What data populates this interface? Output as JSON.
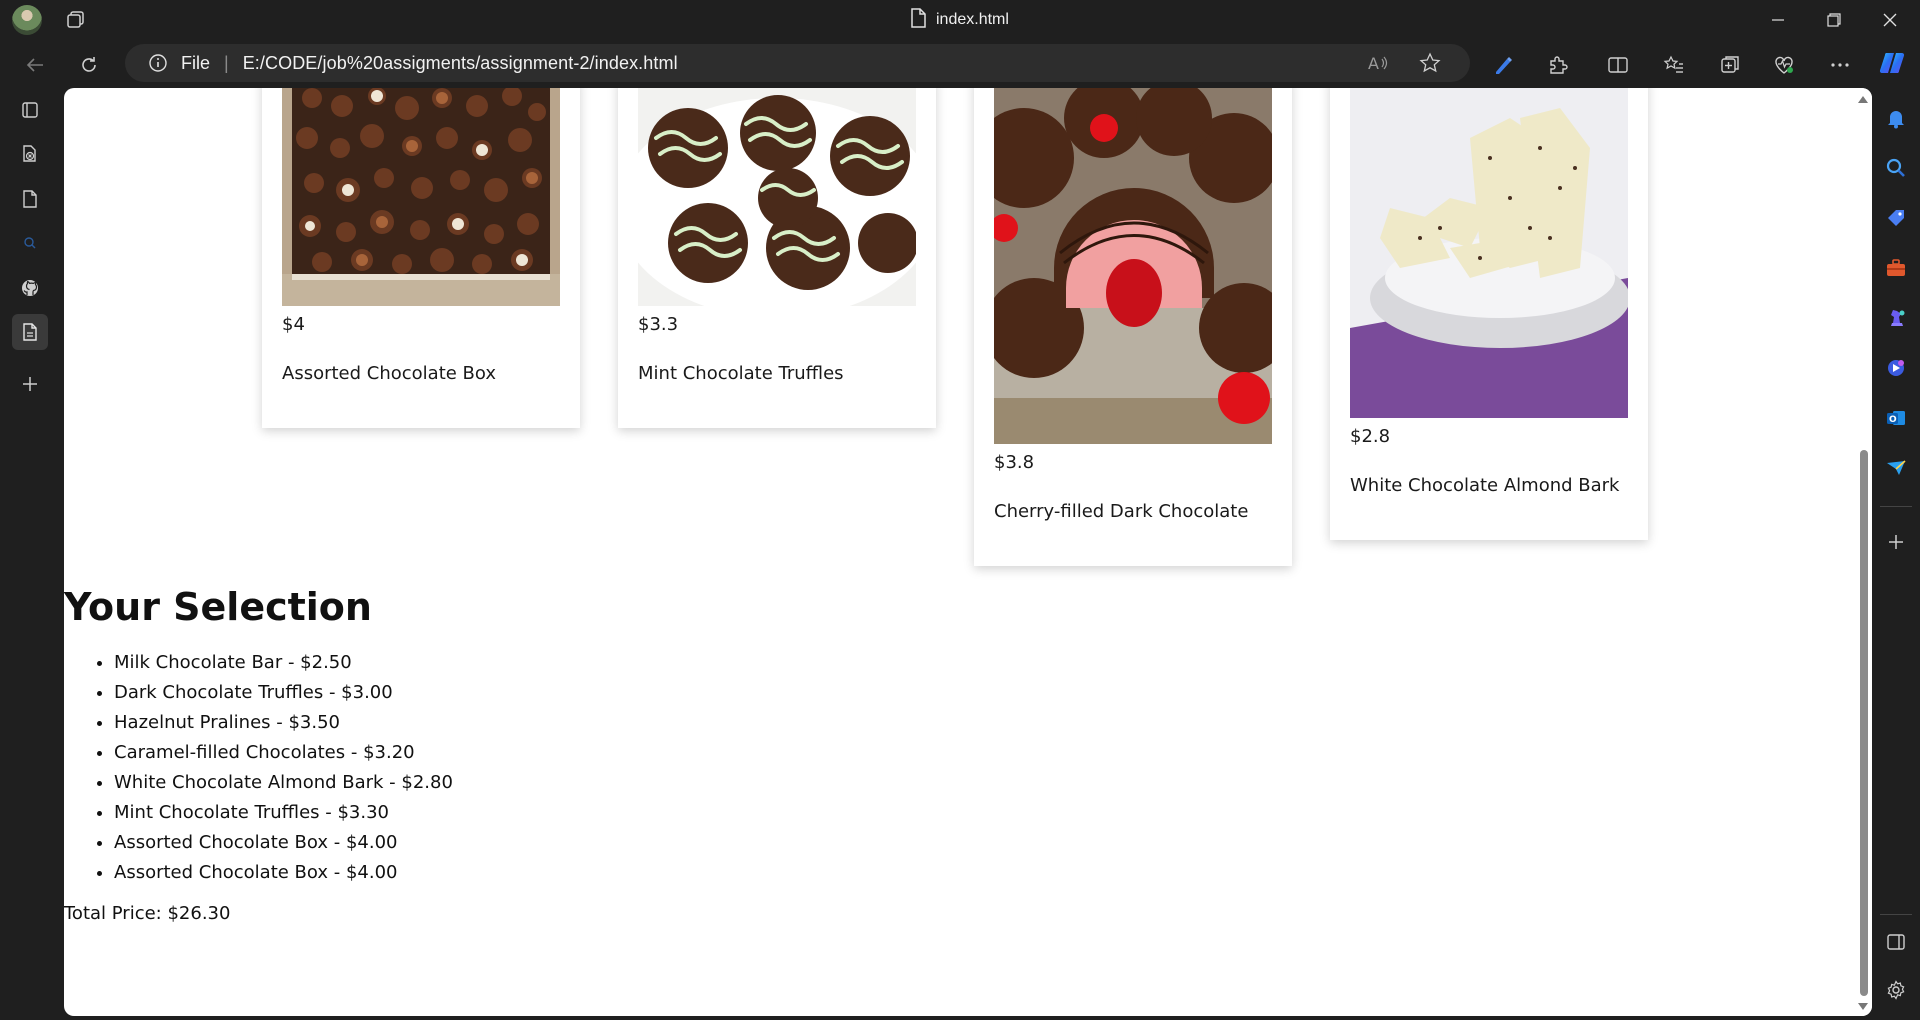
{
  "window": {
    "tab_title": "index.html"
  },
  "address_bar": {
    "scheme_label": "File",
    "url": "E:/CODE/job%20assigments/assignment-2/index.html"
  },
  "products": [
    {
      "price": "$4",
      "name": "Assorted Chocolate Box"
    },
    {
      "price": "$3.3",
      "name": "Mint Chocolate Truffles"
    },
    {
      "price": "$3.8",
      "name": "Cherry-filled Dark Chocolate"
    },
    {
      "price": "$2.8",
      "name": "White Chocolate Almond Bark"
    }
  ],
  "selection": {
    "heading": "Your Selection",
    "items": [
      "Milk Chocolate Bar - $2.50",
      "Dark Chocolate Truffles - $3.00",
      "Hazelnut Pralines - $3.50",
      "Caramel-filled Chocolates - $3.20",
      "White Chocolate Almond Bark - $2.80",
      "Mint Chocolate Truffles - $3.30",
      "Assorted Chocolate Box - $4.00",
      "Assorted Chocolate Box - $4.00"
    ],
    "total": "Total Price: $26.30"
  },
  "colors": {
    "chrome_bg": "#1f1f1f",
    "omnibox_bg": "#2d2d2d",
    "page_bg": "#ffffff",
    "accent": "#1a73e8"
  }
}
